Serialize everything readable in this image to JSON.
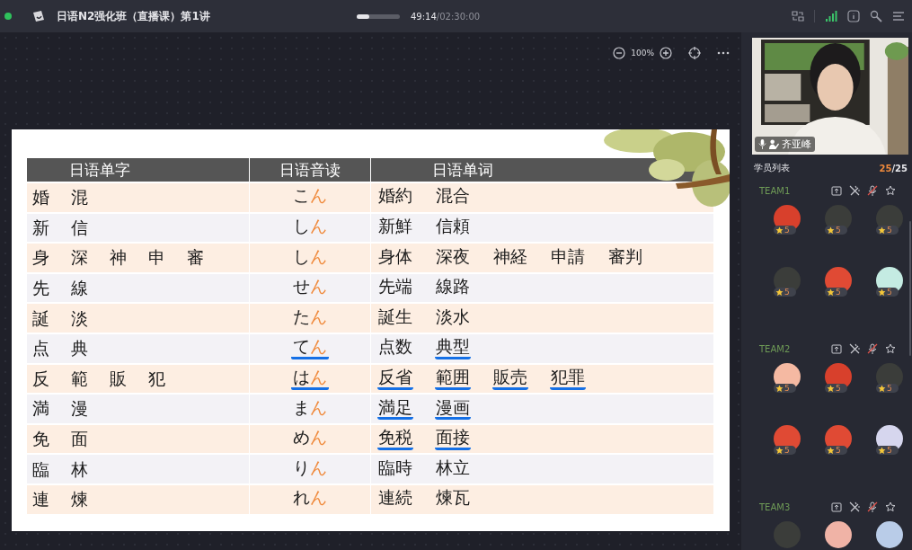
{
  "window": {
    "title": "日语N2强化班（直播课）第1讲",
    "progress": {
      "level": 0.3
    },
    "elapsed": "49:14",
    "total": "/02:30:00"
  },
  "toolbar": {
    "zoom": "100%"
  },
  "slide": {
    "columns": [
      "日语单字",
      "日语音读",
      "日语单词"
    ],
    "rows": [
      {
        "kanji": [
          "婚",
          "混"
        ],
        "reading": {
          "kana": "こ",
          "ending": "ん",
          "underlined": false
        },
        "words": [
          {
            "text": "婚約",
            "underlined": false
          },
          {
            "text": "混合",
            "underlined": false
          }
        ]
      },
      {
        "kanji": [
          "新",
          "信"
        ],
        "reading": {
          "kana": "し",
          "ending": "ん",
          "underlined": false
        },
        "words": [
          {
            "text": "新鮮",
            "underlined": false
          },
          {
            "text": "信頼",
            "underlined": false
          }
        ]
      },
      {
        "kanji": [
          "身",
          "深",
          "神",
          "申",
          "審"
        ],
        "reading": {
          "kana": "し",
          "ending": "ん",
          "underlined": false
        },
        "words": [
          {
            "text": "身体",
            "underlined": false
          },
          {
            "text": "深夜",
            "underlined": false
          },
          {
            "text": "神経",
            "underlined": false
          },
          {
            "text": "申請",
            "underlined": false
          },
          {
            "text": "審判",
            "underlined": false
          }
        ]
      },
      {
        "kanji": [
          "先",
          "線"
        ],
        "reading": {
          "kana": "せ",
          "ending": "ん",
          "underlined": false
        },
        "words": [
          {
            "text": "先端",
            "underlined": false
          },
          {
            "text": "線路",
            "underlined": false
          }
        ]
      },
      {
        "kanji": [
          "誕",
          "淡"
        ],
        "reading": {
          "kana": "た",
          "ending": "ん",
          "underlined": false
        },
        "words": [
          {
            "text": "誕生",
            "underlined": false
          },
          {
            "text": "淡水",
            "underlined": false
          }
        ]
      },
      {
        "kanji": [
          "点",
          "典"
        ],
        "reading": {
          "kana": "て",
          "ending": "ん",
          "underlined": true
        },
        "words": [
          {
            "text": "点数",
            "underlined": false
          },
          {
            "text": "典型",
            "underlined": true
          }
        ]
      },
      {
        "kanji": [
          "反",
          "範",
          "販",
          "犯"
        ],
        "reading": {
          "kana": "は",
          "ending": "ん",
          "underlined": true
        },
        "words": [
          {
            "text": "反省",
            "underlined": true
          },
          {
            "text": "範囲",
            "underlined": true
          },
          {
            "text": "販売",
            "underlined": true
          },
          {
            "text": "犯罪",
            "underlined": true
          }
        ]
      },
      {
        "kanji": [
          "満",
          "漫"
        ],
        "reading": {
          "kana": "ま",
          "ending": "ん",
          "underlined": false
        },
        "words": [
          {
            "text": "満足",
            "underlined": true
          },
          {
            "text": "漫画",
            "underlined": true
          }
        ]
      },
      {
        "kanji": [
          "免",
          "面"
        ],
        "reading": {
          "kana": "め",
          "ending": "ん",
          "underlined": false
        },
        "words": [
          {
            "text": "免税",
            "underlined": true
          },
          {
            "text": "面接",
            "underlined": true
          }
        ]
      },
      {
        "kanji": [
          "臨",
          "林"
        ],
        "reading": {
          "kana": "り",
          "ending": "ん",
          "underlined": false
        },
        "words": [
          {
            "text": "臨時",
            "underlined": false
          },
          {
            "text": "林立",
            "underlined": false
          }
        ]
      },
      {
        "kanji": [
          "連",
          "煉"
        ],
        "reading": {
          "kana": "れ",
          "ending": "ん",
          "underlined": false
        },
        "words": [
          {
            "text": "連続",
            "underlined": false
          },
          {
            "text": "煉瓦",
            "underlined": false
          }
        ]
      }
    ]
  },
  "teacher": {
    "name": "齐亚峰"
  },
  "students": {
    "title": "学员列表",
    "online": "25",
    "total": "/25",
    "teams": [
      {
        "name": "TEAM1",
        "members": [
          {
            "color": "#d8402c",
            "score": "5"
          },
          {
            "color": "#3b3d3a",
            "score": "5"
          },
          {
            "color": "#3b3d3a",
            "score": "5"
          },
          {
            "color": "#3b3d3a",
            "score": "5"
          },
          {
            "color": "#e04a34",
            "score": "5"
          },
          {
            "color": "#c4ebe2",
            "score": "5"
          }
        ]
      },
      {
        "name": "TEAM2",
        "members": [
          {
            "color": "#f5b9a2",
            "score": "5"
          },
          {
            "color": "#d8402c",
            "score": "5"
          },
          {
            "color": "#3b3d3a",
            "score": "5"
          },
          {
            "color": "#e04a34",
            "score": "5"
          },
          {
            "color": "#e04a34",
            "score": "5"
          },
          {
            "color": "#d6d6ee",
            "score": "5"
          }
        ]
      },
      {
        "name": "TEAM3",
        "members": [
          {
            "color": "#3b3d3a"
          },
          {
            "color": "#f0b3a6"
          },
          {
            "color": "#b9cce8"
          }
        ]
      }
    ]
  }
}
